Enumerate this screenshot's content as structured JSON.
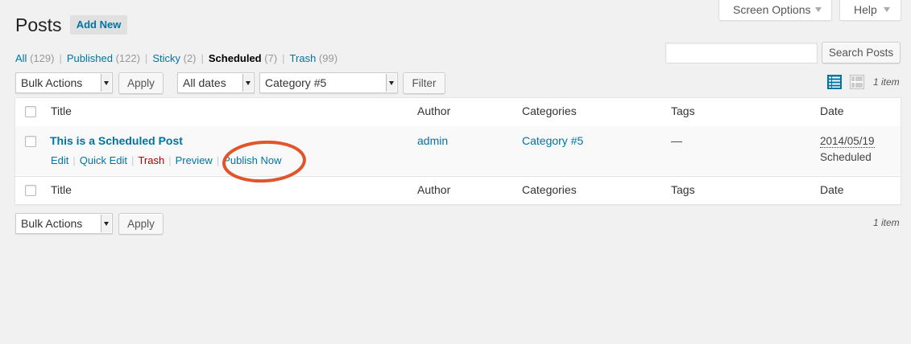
{
  "header": {
    "screen_options": "Screen Options",
    "help": "Help",
    "title": "Posts",
    "add_new": "Add New"
  },
  "views": [
    {
      "label": "All",
      "count": "(129)"
    },
    {
      "label": "Published",
      "count": "(122)"
    },
    {
      "label": "Sticky",
      "count": "(2)"
    },
    {
      "label": "Scheduled",
      "count": "(7)",
      "current": true
    },
    {
      "label": "Trash",
      "count": "(99)"
    }
  ],
  "search": {
    "value": "",
    "button": "Search Posts"
  },
  "tablenav": {
    "bulk_actions": "Bulk Actions",
    "apply": "Apply",
    "dates": "All dates",
    "category": "Category #5",
    "filter": "Filter",
    "items_count": "1 item"
  },
  "table": {
    "columns": [
      "Title",
      "Author",
      "Categories",
      "Tags",
      "Date"
    ],
    "rows": [
      {
        "title": "This is a Scheduled Post",
        "actions": [
          "Edit",
          "Quick Edit",
          "Trash",
          "Preview",
          "Publish Now"
        ],
        "author": "admin",
        "categories": "Category #5",
        "tags": "—",
        "date": "2014/05/19",
        "status": "Scheduled"
      }
    ]
  },
  "colors": {
    "link": "#0074a2",
    "trash": "#aa0000",
    "highlight": "#e0552a",
    "background": "#f1f1f1"
  }
}
